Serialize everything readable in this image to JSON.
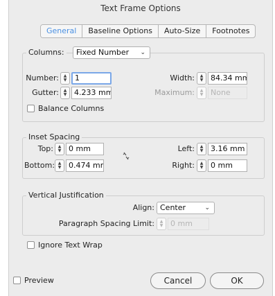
{
  "window": {
    "title": "Text Frame Options"
  },
  "tabs": [
    {
      "label": "General",
      "active": true
    },
    {
      "label": "Baseline Options",
      "active": false
    },
    {
      "label": "Auto-Size",
      "active": false
    },
    {
      "label": "Footnotes",
      "active": false
    }
  ],
  "columns": {
    "label": "Columns:",
    "type_selected": "Fixed Number",
    "number_label": "Number:",
    "number_value": "1",
    "width_label": "Width:",
    "width_value": "84.34 mm",
    "gutter_label": "Gutter:",
    "gutter_value": "4.233 mm",
    "maximum_label": "Maximum:",
    "maximum_value": "None",
    "balance_label": "Balance Columns"
  },
  "inset": {
    "legend": "Inset Spacing",
    "top_label": "Top:",
    "top_value": "0 mm",
    "bottom_label": "Bottom:",
    "bottom_value": "0.474 mm",
    "left_label": "Left:",
    "left_value": "3.16 mm",
    "right_label": "Right:",
    "right_value": "0 mm"
  },
  "vertical": {
    "legend": "Vertical Justification",
    "align_label": "Align:",
    "align_selected": "Center",
    "para_label": "Paragraph Spacing Limit:",
    "para_value": "0 mm"
  },
  "ignore_wrap_label": "Ignore Text Wrap",
  "footer": {
    "preview_label": "Preview",
    "cancel_label": "Cancel",
    "ok_label": "OK"
  }
}
